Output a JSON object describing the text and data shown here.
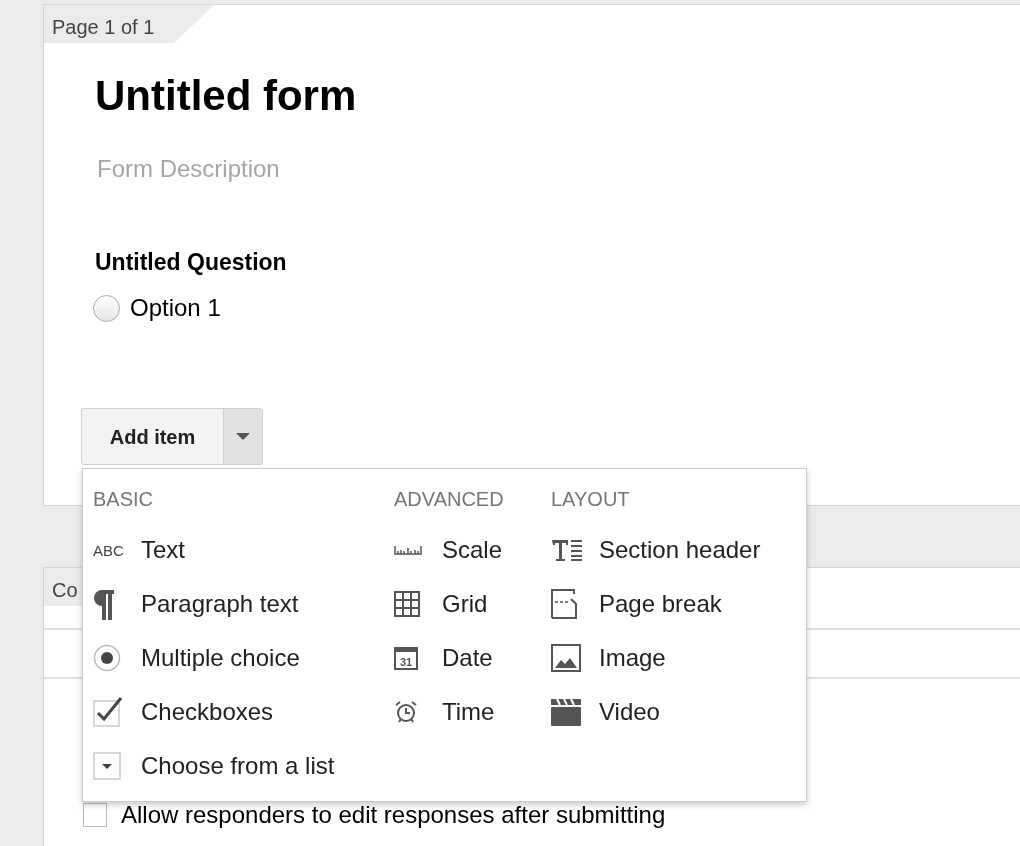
{
  "page_tab": "Page 1 of 1",
  "form": {
    "title": "Untitled form",
    "description_placeholder": "Form Description"
  },
  "question": {
    "title": "Untitled Question",
    "options": [
      {
        "label": "Option 1",
        "selected": false
      }
    ]
  },
  "add_item": {
    "label": "Add item"
  },
  "menu": {
    "columns": [
      {
        "heading": "BASIC",
        "items": [
          {
            "kind": "abc",
            "icon_text": "ABC",
            "label": "Text"
          },
          {
            "kind": "paragraph",
            "label": "Paragraph text"
          },
          {
            "kind": "radio",
            "label": "Multiple choice"
          },
          {
            "kind": "checkbox",
            "label": "Checkboxes"
          },
          {
            "kind": "dropdown",
            "label": "Choose from a list"
          }
        ]
      },
      {
        "heading": "ADVANCED",
        "items": [
          {
            "kind": "scale",
            "label": "Scale"
          },
          {
            "kind": "grid",
            "label": "Grid"
          },
          {
            "kind": "date",
            "icon_text": "31",
            "label": "Date"
          },
          {
            "kind": "time",
            "label": "Time"
          }
        ]
      },
      {
        "heading": "LAYOUT",
        "items": [
          {
            "kind": "section",
            "label": "Section header"
          },
          {
            "kind": "pagebreak",
            "label": "Page break"
          },
          {
            "kind": "image",
            "label": "Image"
          },
          {
            "kind": "video",
            "label": "Video"
          }
        ]
      }
    ]
  },
  "settings_card": {
    "tab": "Co",
    "checkbox": {
      "label": "Allow responders to edit responses after submitting",
      "checked": false
    }
  }
}
